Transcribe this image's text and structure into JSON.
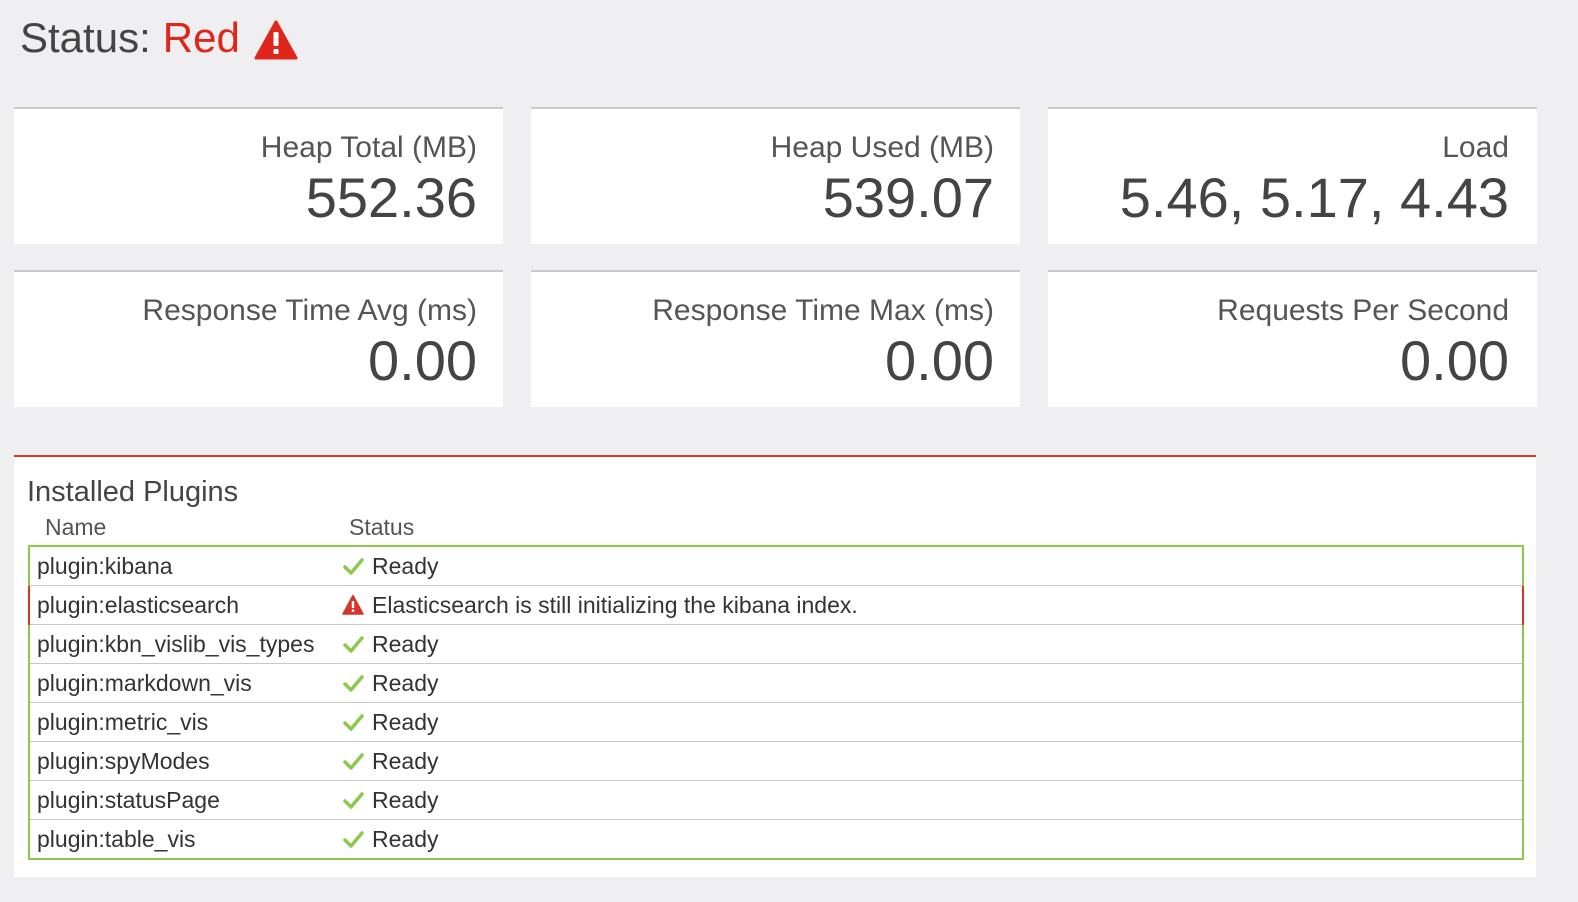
{
  "status": {
    "label": "Status:",
    "value": "Red",
    "color": "#e0261b",
    "icon": "warning-icon"
  },
  "metrics": [
    {
      "title": "Heap Total (MB)",
      "value": "552.36"
    },
    {
      "title": "Heap Used (MB)",
      "value": "539.07"
    },
    {
      "title": "Load",
      "value": "5.46, 5.17, 4.43"
    },
    {
      "title": "Response Time Avg (ms)",
      "value": "0.00"
    },
    {
      "title": "Response Time Max (ms)",
      "value": "0.00"
    },
    {
      "title": "Requests Per Second",
      "value": "0.00"
    }
  ],
  "plugins": {
    "title": "Installed Plugins",
    "columns": {
      "name": "Name",
      "status": "Status"
    },
    "rows": [
      {
        "name": "plugin:kibana",
        "status": "Ready",
        "state": "green",
        "icon": "check-icon"
      },
      {
        "name": "plugin:elasticsearch",
        "status": "Elasticsearch is still initializing the kibana index.",
        "state": "red",
        "icon": "warning-icon"
      },
      {
        "name": "plugin:kbn_vislib_vis_types",
        "status": "Ready",
        "state": "green",
        "icon": "check-icon"
      },
      {
        "name": "plugin:markdown_vis",
        "status": "Ready",
        "state": "green",
        "icon": "check-icon"
      },
      {
        "name": "plugin:metric_vis",
        "status": "Ready",
        "state": "green",
        "icon": "check-icon"
      },
      {
        "name": "plugin:spyModes",
        "status": "Ready",
        "state": "green",
        "icon": "check-icon"
      },
      {
        "name": "plugin:statusPage",
        "status": "Ready",
        "state": "green",
        "icon": "check-icon"
      },
      {
        "name": "plugin:table_vis",
        "status": "Ready",
        "state": "green",
        "icon": "check-icon"
      }
    ]
  },
  "colors": {
    "green": "#8cc94b",
    "red": "#d5352a",
    "background": "#efeff1"
  }
}
